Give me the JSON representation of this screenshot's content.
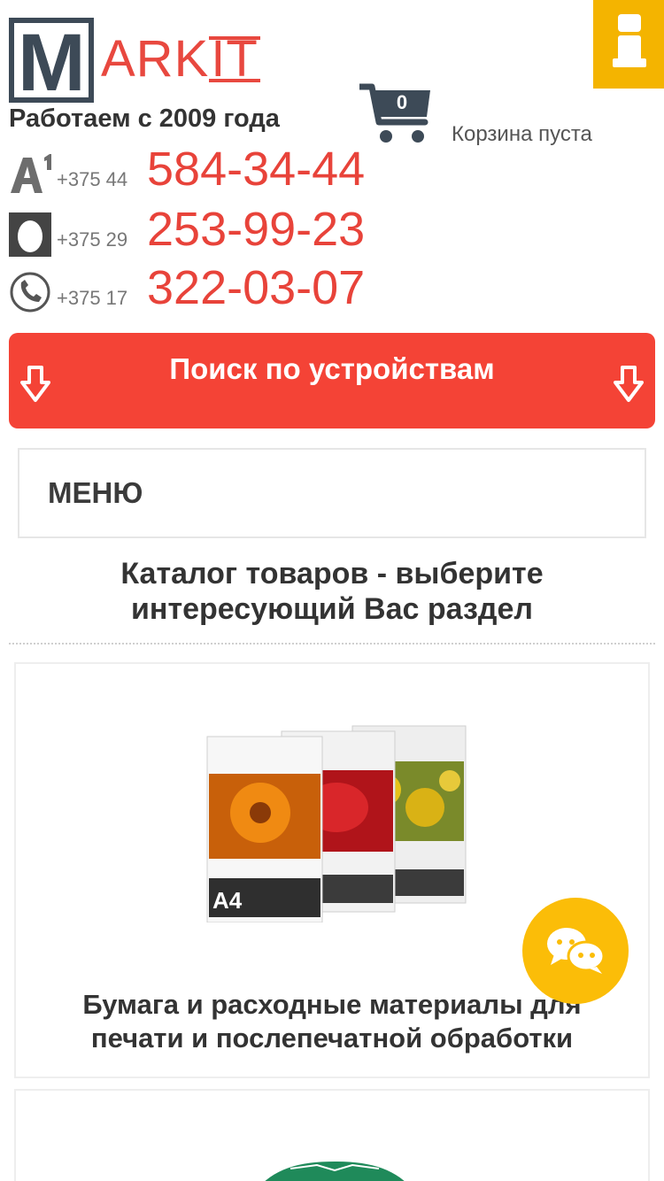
{
  "logo": {
    "letter": "M",
    "text": "ARK",
    "text_suffix": "IT"
  },
  "header": {
    "since": "Работаем с 2009 года"
  },
  "cart": {
    "count": "0",
    "status": "Корзина пуста"
  },
  "phones": [
    {
      "operator_icon": "a1-operator-icon",
      "prefix": "+375 44",
      "number": "584-34-44"
    },
    {
      "operator_icon": "mts-operator-icon",
      "prefix": "+375 29",
      "number": "253-99-23"
    },
    {
      "operator_icon": "landline-phone-icon",
      "prefix": "+375 17",
      "number": "322-03-07"
    }
  ],
  "search": {
    "label": "Поиск по устройствам"
  },
  "menu": {
    "label": "МЕНЮ"
  },
  "catalog": {
    "title_line1": "Каталог товаров - выберите",
    "title_line2": "интересующий Вас раздел",
    "items": [
      {
        "title_line1": "Бумага и расходные материалы для",
        "title_line2": "печати и послепечатной обработки"
      }
    ]
  },
  "colors": {
    "accent_red": "#f44336",
    "brand_dark": "#3d4a57",
    "info_yellow": "#f4b400",
    "chat_yellow": "#fbbd08"
  }
}
